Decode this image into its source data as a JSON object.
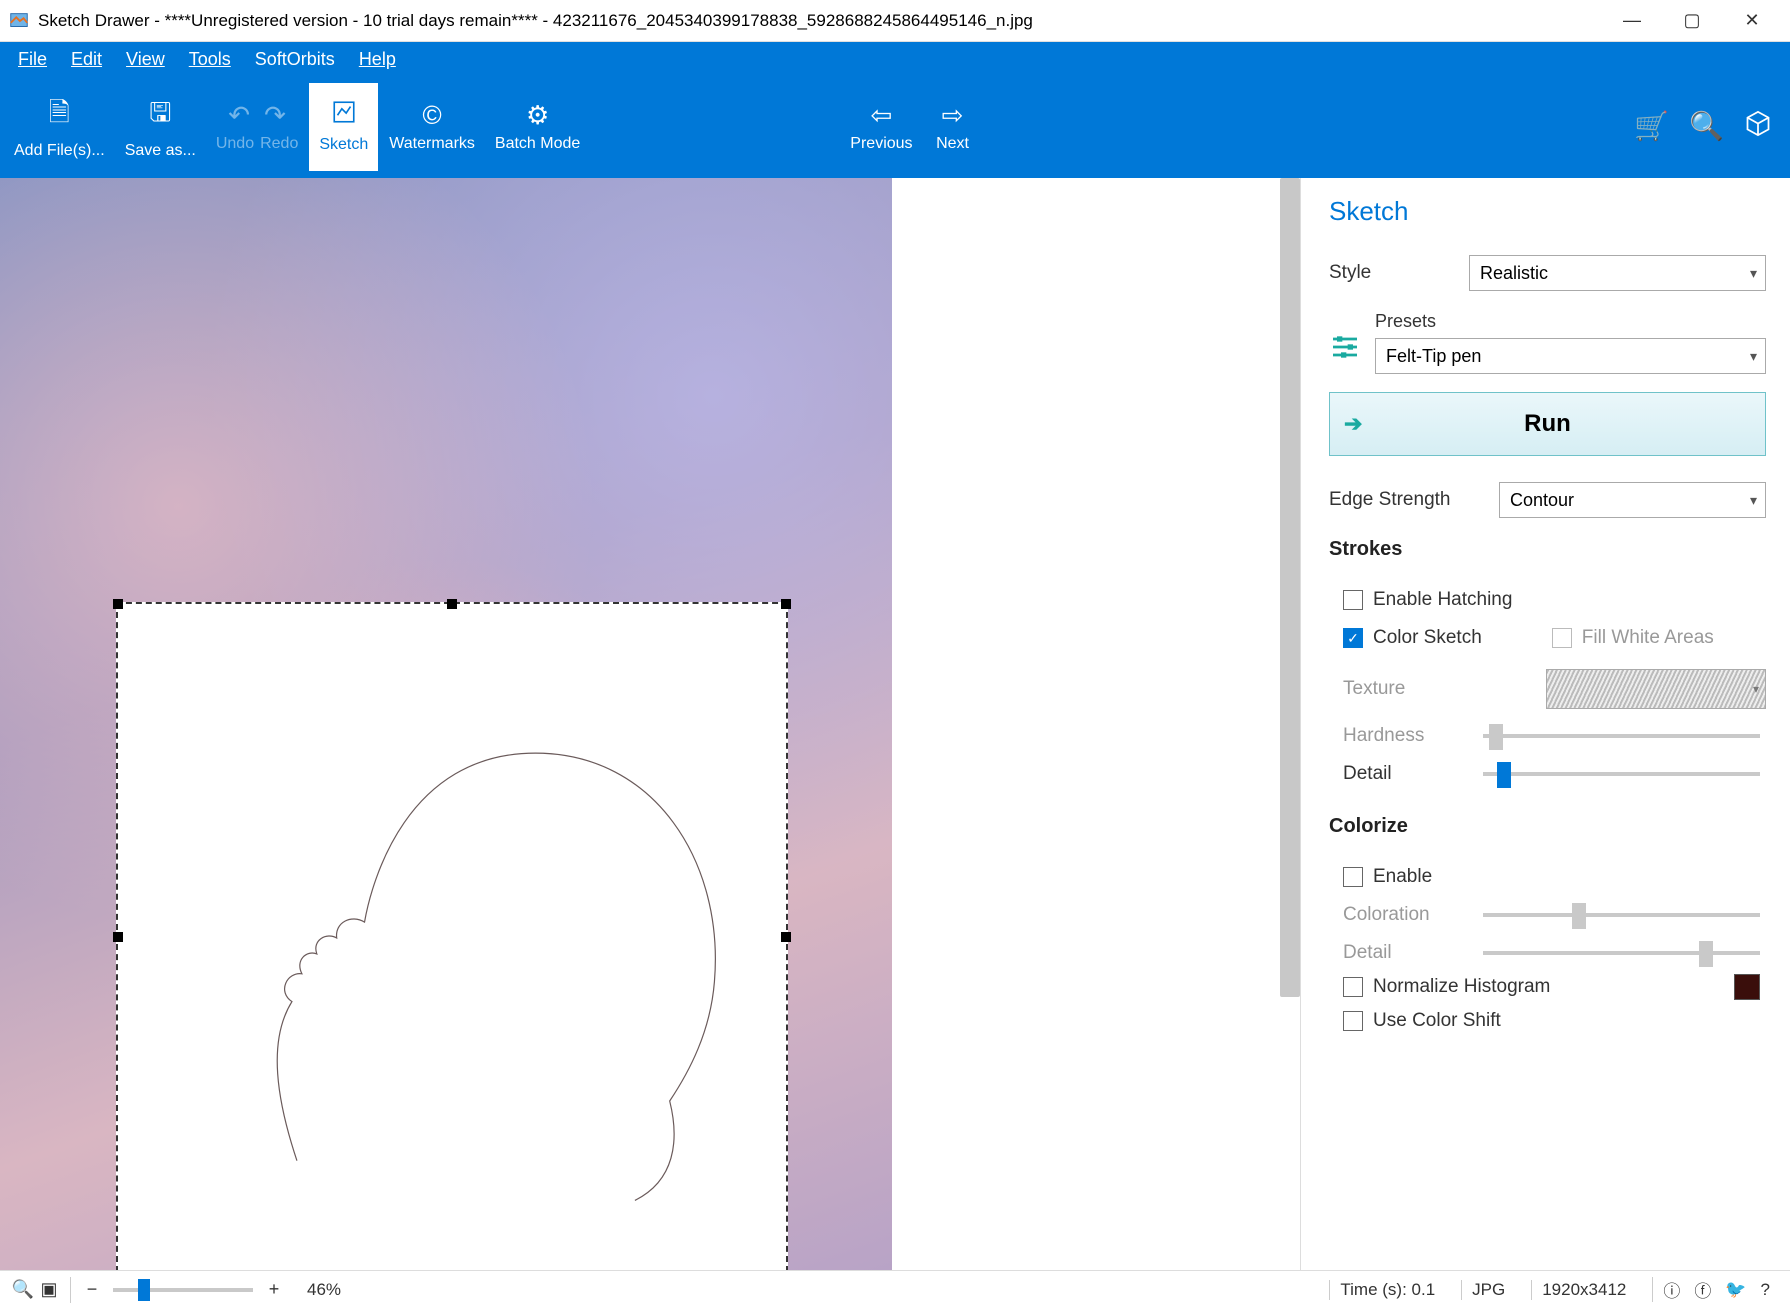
{
  "titlebar": {
    "title": "Sketch Drawer - ****Unregistered version - 10 trial days remain**** - 423211676_2045340399178838_5928688245864495146_n.jpg"
  },
  "menu": {
    "file": "File",
    "edit": "Edit",
    "view": "View",
    "tools": "Tools",
    "softorbits": "SoftOrbits",
    "help": "Help"
  },
  "toolbar": {
    "add": "Add File(s)...",
    "save": "Save as...",
    "undo": "Undo",
    "redo": "Redo",
    "sketch": "Sketch",
    "watermarks": "Watermarks",
    "batch": "Batch Mode",
    "previous": "Previous",
    "next": "Next"
  },
  "panel": {
    "title": "Sketch",
    "style_label": "Style",
    "style_value": "Realistic",
    "presets_label": "Presets",
    "presets_value": "Felt-Tip pen",
    "run": "Run",
    "edge_label": "Edge Strength",
    "edge_value": "Contour",
    "strokes": {
      "title": "Strokes",
      "enable_hatching": "Enable Hatching",
      "color_sketch": "Color Sketch",
      "fill_white": "Fill White Areas",
      "texture": "Texture",
      "hardness": "Hardness",
      "detail": "Detail"
    },
    "colorize": {
      "title": "Colorize",
      "enable": "Enable",
      "coloration": "Coloration",
      "detail": "Detail",
      "normalize": "Normalize Histogram",
      "color_shift": "Use Color Shift",
      "swatch": "#3a0e0b"
    }
  },
  "status": {
    "zoom_pct": "46%",
    "time": "Time (s): 0.1",
    "format": "JPG",
    "dimensions": "1920x3412"
  },
  "sliders": {
    "hardness_pos_pct": 2,
    "strokes_detail_pos_pct": 5,
    "colorize_coloration_pos_pct": 32,
    "colorize_detail_pos_pct": 78,
    "zoom_pos_pct": 18
  }
}
